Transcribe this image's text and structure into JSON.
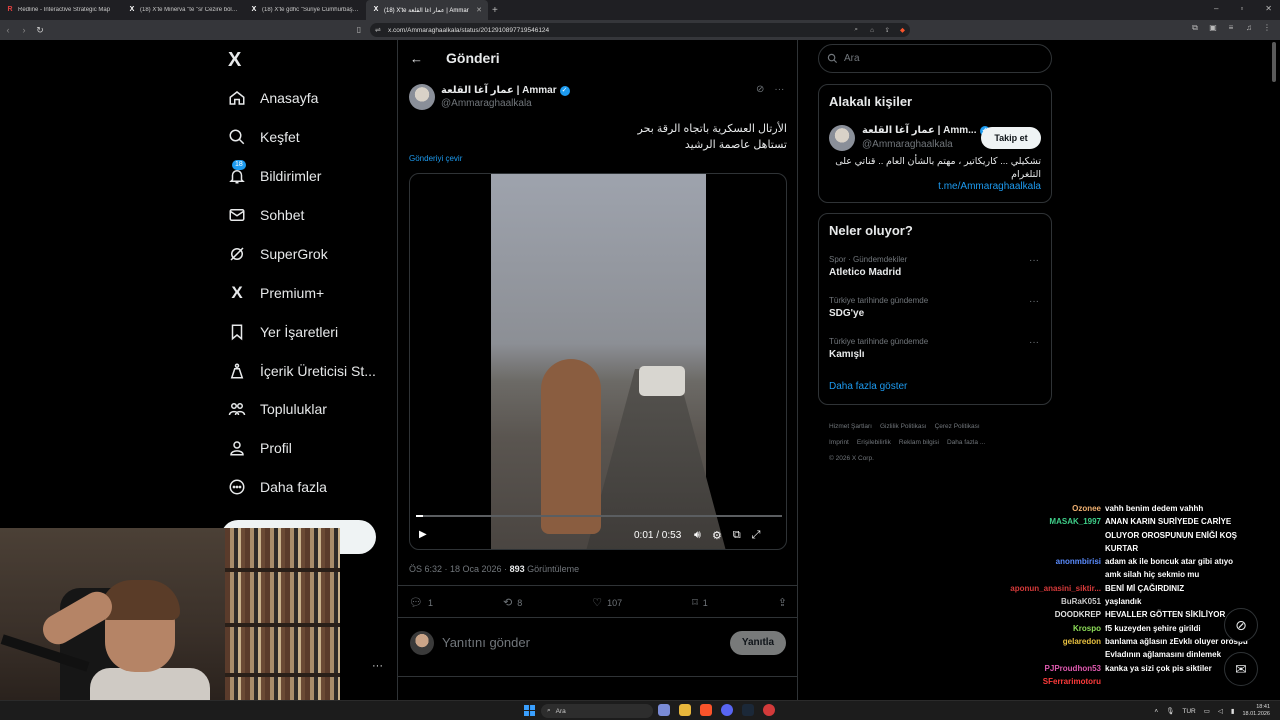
{
  "browser": {
    "tabs": [
      {
        "favicon": "R",
        "title": "Redline - Interactive Strategic Map",
        "active": false
      },
      {
        "favicon": "X",
        "title": "(18) X'te Minerva \"te \"sr Cezire bölge",
        "active": false
      },
      {
        "favicon": "X",
        "title": "(18) X'te gdhc \"Suriye Cumhurbaşkanı",
        "active": false
      },
      {
        "favicon": "X",
        "title": "(18) X'te عمار آغا القلعة | Ammar",
        "active": true
      }
    ],
    "url": "x.com/Ammaraghaalkala/status/2012910897719546124",
    "new_tab": "+"
  },
  "sidebar": {
    "logo": "X",
    "items": [
      {
        "label": "Anasayfa",
        "icon": "home-icon"
      },
      {
        "label": "Keşfet",
        "icon": "search-icon"
      },
      {
        "label": "Bildirimler",
        "icon": "bell-icon",
        "badge": "18"
      },
      {
        "label": "Sohbet",
        "icon": "mail-icon"
      },
      {
        "label": "SuperGrok",
        "icon": "grok-icon"
      },
      {
        "label": "Premium+",
        "icon": "x-premium-icon"
      },
      {
        "label": "Yer İşaretleri",
        "icon": "bookmark-icon"
      },
      {
        "label": "İçerik Üreticisi St...",
        "icon": "creator-studio-icon"
      },
      {
        "label": "Topluluklar",
        "icon": "communities-icon"
      },
      {
        "label": "Profil",
        "icon": "profile-icon"
      },
      {
        "label": "Daha fazla",
        "icon": "more-circle-icon"
      }
    ]
  },
  "post": {
    "header_title": "Gönderi",
    "author_name": "عمار آغا القلعة | Ammar",
    "author_handle": "@Ammaraghaalkala",
    "text_line1": "الأرتال العسكرية باتجاه الرقة بحر",
    "text_line2": "تستاهل عاصمة الرشيد",
    "translate": "Gönderiyi çevir",
    "video": {
      "current": "0:01",
      "duration": "0:53",
      "time_display": "0:01 / 0:53",
      "progress": 0.02
    },
    "time": "ÖS 6:32 · 18 Oca 2026 · ",
    "views": "893",
    "views_label": " Görüntüleme",
    "stats": {
      "replies": "1",
      "reposts": "8",
      "likes": "107",
      "bookmarks": "1"
    },
    "reply_placeholder": "Yanıtını gönder",
    "reply_button": "Yanıtla"
  },
  "right": {
    "search_placeholder": "Ara",
    "related_title": "Alakalı kişiler",
    "related": {
      "name": "عمار آغا القلعة | Amm...",
      "handle": "@Ammaraghaalkala",
      "follow": "Takip et",
      "bio": "تشكيلي ... كاريكاتير ، مهتم بالشأن العام .. قناتي على التلغرام",
      "link": "t.me/Ammaraghaalkala"
    },
    "trends_title": "Neler oluyor?",
    "trends": [
      {
        "context": "Spor · Gündemdekiler",
        "name": "Atletico Madrid"
      },
      {
        "context": "Türkiye tarihinde gündemde",
        "name": "SDG'ye"
      },
      {
        "context": "Türkiye tarihinde gündemde",
        "name": "Kamışlı"
      }
    ],
    "show_more": "Daha fazla göster",
    "footer": [
      "Hizmet Şartları",
      "Gizlilik Politikası",
      "Çerez Politikası",
      "Imprint",
      "Erişilebilirlik",
      "Reklam bilgisi",
      "Daha fazla ...",
      "© 2026 X Corp."
    ]
  },
  "chat": [
    {
      "user": "Ozonee",
      "color": "#f0b070",
      "msg": "vahh benim dedem vahhh"
    },
    {
      "user": "MASAK_1997",
      "color": "#3fd08a",
      "msg": "ANAN KARIN SURİYEDE CARİYE"
    },
    {
      "user": "",
      "color": "#ffffff",
      "msg": "OLUYOR OROSPUNUN ENİĞİ KOŞ"
    },
    {
      "user": "",
      "color": "#ffffff",
      "msg": "KURTAR"
    },
    {
      "user": "anonmbirisi",
      "color": "#5a8cff",
      "msg": "adam ak ile boncuk atar gibi atıyo"
    },
    {
      "user": "",
      "color": "#ffffff",
      "msg": "amk silah hiç sekmio mu"
    },
    {
      "user": "aponun_anasini_siktir...",
      "color": "#d63a3a",
      "msg": "BENİ Mİ ÇAĞIRDINIZ"
    },
    {
      "user": "BuRaK051",
      "color": "#c8c8c8",
      "msg": "yaşlandık"
    },
    {
      "user": "DOODKREP",
      "color": "#e0e0e0",
      "msg": "HEVALLER GÖTTEN SİKİLİYOR"
    },
    {
      "user": "Krospo",
      "color": "#8fe05a",
      "msg": "f5 kuzeyden şehire girildi"
    },
    {
      "user": "gelaredon",
      "color": "#e8c040",
      "msg": "banlama ağlasın zEvklı oluyer orospu"
    },
    {
      "user": "",
      "color": "#ffffff",
      "msg": "Evladının ağlamasını dinlemek"
    },
    {
      "user": "PJProudhon53",
      "color": "#e05ab0",
      "msg": "kanka ya sizi çok pis siktiler"
    },
    {
      "user": "SFerrarimotoru",
      "color": "#ff3b3b",
      "msg": ""
    }
  ],
  "taskbar": {
    "search": "Ara",
    "lang": "TUR",
    "time": "18:41",
    "date": "18.01.2026"
  }
}
